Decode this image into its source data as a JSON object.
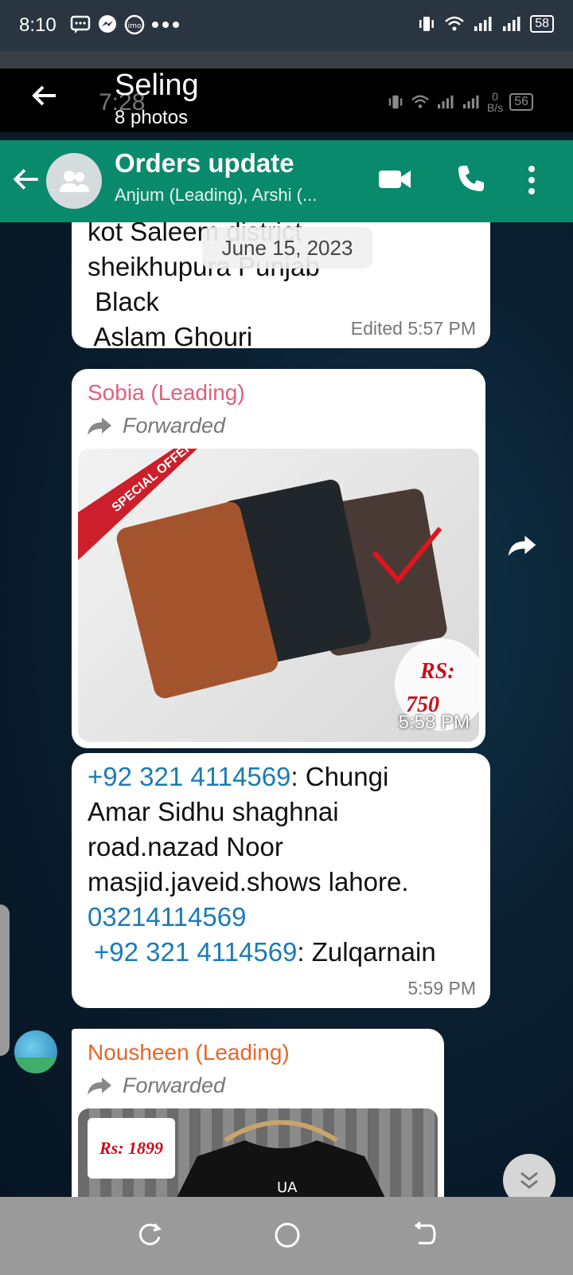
{
  "status_bar": {
    "time": "8:10",
    "battery": "58"
  },
  "gallery_header": {
    "title": "Seling",
    "subtitle": "8 photos",
    "ghost_time": "7:28",
    "ghost_speed_value": "0",
    "ghost_speed_unit": "B/s",
    "ghost_battery": "56"
  },
  "chat_header": {
    "group_name": "Orders update",
    "members": "Anjum (Leading), Arshi (..."
  },
  "date_chip": "June 15, 2023",
  "messages": [
    {
      "lines": [
        "kot Saleem district",
        "sheikhupura Punjab",
        " Black",
        " Aslam Ghouri"
      ],
      "meta": "Edited 5:57 PM"
    },
    {
      "sender": "Sobia (Leading)",
      "forwarded": "Forwarded",
      "image_badge": "SPECIAL OFFER",
      "price_label": "RS:",
      "price_value": "750",
      "time": "5:58 PM"
    },
    {
      "link1": "+92 321 4114569",
      "text1": ": Chungi",
      "text2": "Amar Sidhu shaghnai",
      "text3": "road.nazad Noor",
      "text4": "masjid.javeid.shows lahore.",
      "link2": "03214114569",
      "link3": "+92 321 4114569",
      "text5": ": Zulqarnain",
      "time": "5:59 PM"
    },
    {
      "sender": "Nousheen (Leading)",
      "forwarded": "Forwarded",
      "price_tag": "Rs: 1899"
    }
  ],
  "colors": {
    "header_green": "#0a8a6c",
    "sobia_sender": "#e0607a",
    "nousheen_sender": "#e8652a",
    "link": "#1b7bb6"
  }
}
